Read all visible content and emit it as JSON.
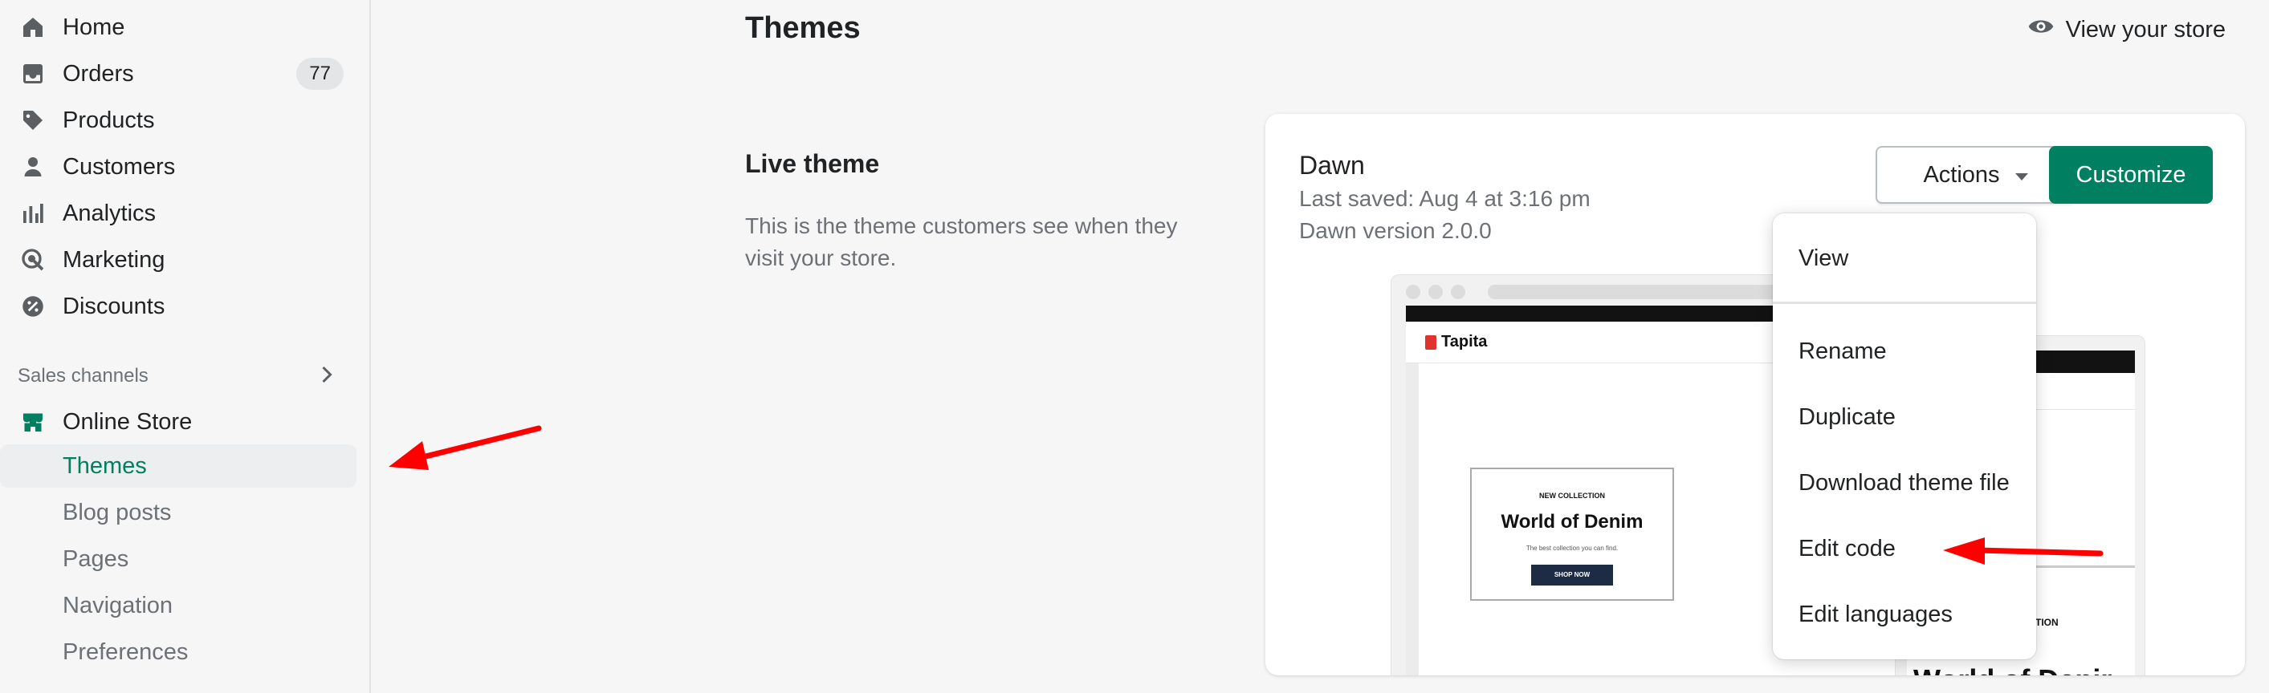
{
  "sidebar": {
    "items": [
      {
        "label": "Home",
        "icon": "home-icon"
      },
      {
        "label": "Orders",
        "icon": "orders-icon",
        "count": "77"
      },
      {
        "label": "Products",
        "icon": "tag-icon"
      },
      {
        "label": "Customers",
        "icon": "person-icon"
      },
      {
        "label": "Analytics",
        "icon": "bar-chart-icon"
      },
      {
        "label": "Marketing",
        "icon": "target-icon"
      },
      {
        "label": "Discounts",
        "icon": "discount-icon"
      }
    ],
    "sales_channels_title": "Sales channels",
    "online_store": {
      "label": "Online Store",
      "icon": "store-icon"
    },
    "sub_items": [
      "Themes",
      "Blog posts",
      "Pages",
      "Navigation",
      "Preferences"
    ],
    "active_sub_item": "Themes"
  },
  "header": {
    "title": "Themes",
    "view_store_label": "View your store"
  },
  "live_theme": {
    "section_title": "Live theme",
    "description": "This is the theme customers see when they visit your store."
  },
  "theme_card": {
    "name": "Dawn",
    "last_saved": "Last saved: Aug 4 at 3:16 pm",
    "version": "Dawn version 2.0.0",
    "actions_label": "Actions",
    "customize_label": "Customize"
  },
  "preview": {
    "logo_text": "Tapita",
    "kicker": "NEW COLLECTION",
    "heading": "World of Denim",
    "subtext": "The best collection you can find.",
    "button": "SHOP NOW",
    "mobile_kicker": "TION",
    "mobile_heading": "World of Denir"
  },
  "actions_menu": {
    "items": [
      "View",
      "Rename",
      "Duplicate",
      "Download theme file",
      "Edit code",
      "Edit languages"
    ]
  },
  "colors": {
    "accent": "#008060",
    "annotation_arrow": "#ff0000"
  }
}
